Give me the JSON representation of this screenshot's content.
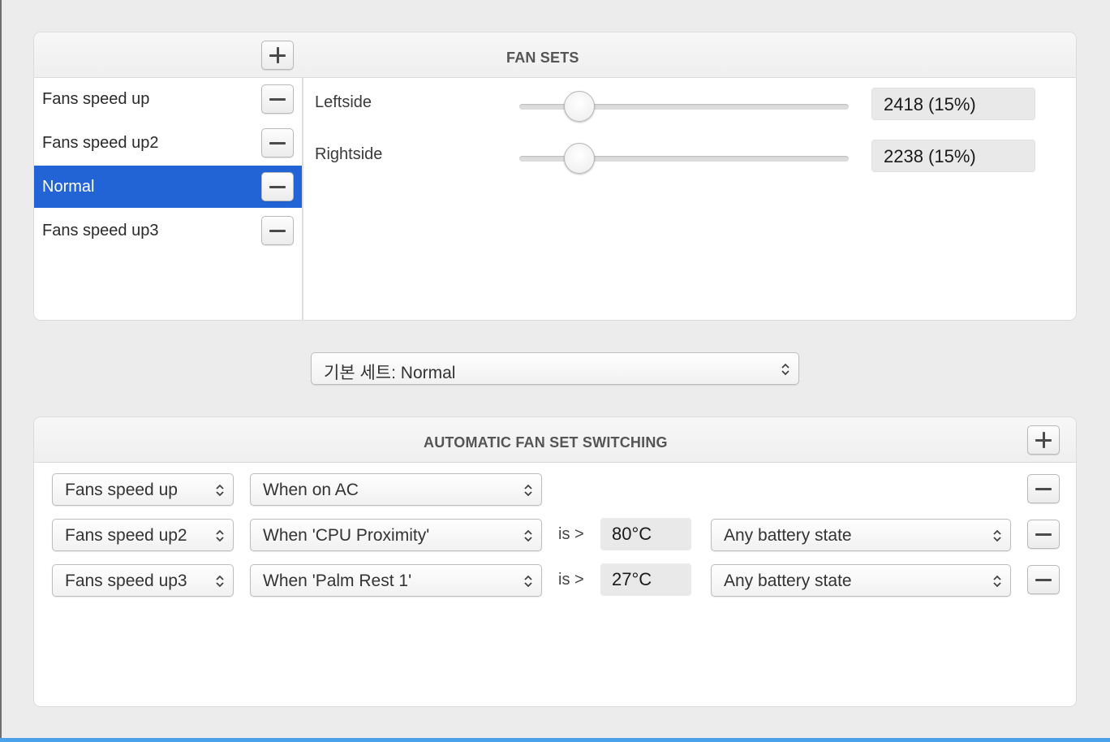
{
  "fan_sets": {
    "title": "FAN SETS",
    "add_label": "+",
    "sets": [
      {
        "label": "Fans speed up",
        "selected": false
      },
      {
        "label": "Fans speed up2",
        "selected": false
      },
      {
        "label": "Normal",
        "selected": true
      },
      {
        "label": "Fans speed up3",
        "selected": false
      }
    ],
    "fans": [
      {
        "label": "Leftside",
        "value": "2418 (15%)",
        "level": 0.15
      },
      {
        "label": "Rightside",
        "value": "2238 (15%)",
        "level": 0.15
      }
    ]
  },
  "default_set": {
    "label": "기본 세트: Normal"
  },
  "auto_switching": {
    "title": "AUTOMATIC FAN SET SWITCHING",
    "rules": [
      {
        "set": "Fans speed up",
        "condition": "When on AC"
      },
      {
        "set": "Fans speed up2",
        "condition": "When 'CPU Proximity'",
        "operator": "is >",
        "threshold": "80°C",
        "battery": "Any battery state"
      },
      {
        "set": "Fans speed up3",
        "condition": "When 'Palm Rest 1'",
        "operator": "is >",
        "threshold": "27°C",
        "battery": "Any battery state"
      }
    ]
  },
  "colors": {
    "selection": "#2264d6",
    "accent_bar": "#4aa3ea"
  },
  "icons": {
    "add": "plus-icon",
    "remove": "minus-icon",
    "popup": "chevron-up-down-icon"
  }
}
